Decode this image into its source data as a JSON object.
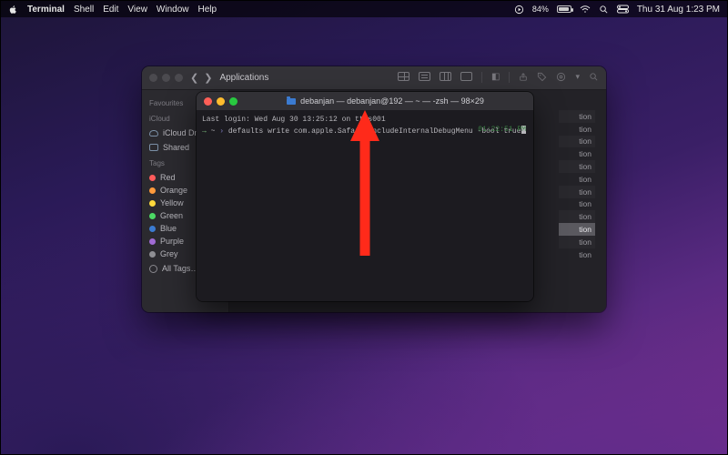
{
  "menubar": {
    "app_name": "Terminal",
    "items": [
      "Shell",
      "Edit",
      "View",
      "Window",
      "Help"
    ],
    "battery_text": "84%",
    "datetime": "Thu 31 Aug  1:23 PM"
  },
  "finder": {
    "title": "Applications",
    "sidebar": {
      "favourites_label": "Favourites",
      "icloud_label": "iCloud",
      "icloud_items": [
        "iCloud Drive",
        "Shared"
      ],
      "tags_label": "Tags",
      "tags": [
        {
          "name": "Red",
          "color": "#ff5b5b"
        },
        {
          "name": "Orange",
          "color": "#ff9a3c"
        },
        {
          "name": "Yellow",
          "color": "#ffd93c"
        },
        {
          "name": "Green",
          "color": "#4cd964"
        },
        {
          "name": "Blue",
          "color": "#3b7bd1"
        },
        {
          "name": "Purple",
          "color": "#a06bd4"
        },
        {
          "name": "Grey",
          "color": "#8e8e93"
        }
      ],
      "all_tags_label": "All Tags…"
    },
    "content": {
      "visible_row_suffix_count": 12,
      "row_suffix": "tion",
      "selected_index": 9
    }
  },
  "terminal": {
    "title": "debanjan — debanjan@192 — ~ — -zsh — 98×29",
    "last_login": "Last login: Wed Aug 30 13:25:12 on ttys001",
    "prompt_path": "~",
    "command": "defaults write com.apple.Safari IncludeInternalDebugMenu -bool true",
    "clock": "01:22:51 PM"
  },
  "annotation": {
    "arrow_color": "#ff2a1a"
  }
}
